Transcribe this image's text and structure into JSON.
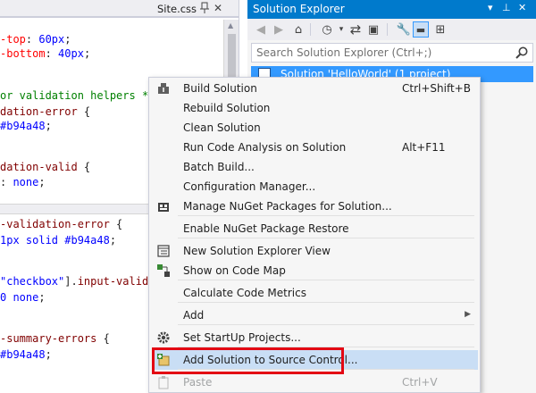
{
  "colors": {
    "accent": "#007acc",
    "selection": "#3399ff",
    "menu_highlight": "#c9def5",
    "callout_border": "#e30613",
    "css_property": "#ff0000",
    "css_value": "#0000ff",
    "css_comment": "#008000"
  },
  "editor": {
    "tab_name": "Site.css",
    "pin_icon": "pin-icon",
    "close_icon": "close-icon",
    "lines_top": [
      {
        "parts": [
          [
            "prop",
            "-top"
          ],
          [
            "txt",
            ": "
          ],
          [
            "val",
            "60px"
          ],
          [
            "txt",
            ";"
          ]
        ]
      },
      {
        "parts": [
          [
            "prop",
            "-bottom"
          ],
          [
            "txt",
            ": "
          ],
          [
            "val",
            "40px"
          ],
          [
            "txt",
            ";"
          ]
        ]
      },
      {
        "parts": [
          [
            "com",
            "or validation helpers */"
          ]
        ]
      },
      {
        "parts": [
          [
            "sel",
            "dation-error"
          ],
          [
            "txt",
            " {"
          ]
        ]
      },
      {
        "parts": [
          [
            "val",
            "#b94a48"
          ],
          [
            "txt",
            ";"
          ]
        ]
      },
      {
        "parts": [
          [
            "sel",
            "dation-valid"
          ],
          [
            "txt",
            " {"
          ]
        ]
      },
      {
        "parts": [
          [
            "txt",
            ": "
          ],
          [
            "val",
            "none"
          ],
          [
            "txt",
            ";"
          ]
        ]
      }
    ],
    "lines_bottom": [
      {
        "parts": [
          [
            "sel",
            "-validation-error"
          ],
          [
            "txt",
            " {"
          ]
        ]
      },
      {
        "parts": [
          [
            "val",
            "1px solid #b94a48"
          ],
          [
            "txt",
            ";"
          ]
        ]
      },
      {
        "parts": [
          [
            "val",
            "\"checkbox\""
          ],
          [
            "txt",
            "]."
          ],
          [
            "sel",
            "input-validat"
          ]
        ]
      },
      {
        "parts": [
          [
            "val",
            "0 none"
          ],
          [
            "txt",
            ";"
          ]
        ]
      },
      {
        "parts": [
          [
            "sel",
            "-summary-errors"
          ],
          [
            "txt",
            " {"
          ]
        ]
      },
      {
        "parts": [
          [
            "val",
            "#b94a48"
          ],
          [
            "txt",
            ";"
          ]
        ]
      }
    ]
  },
  "solution_explorer": {
    "title": "Solution Explorer",
    "title_controls": [
      "▾",
      "⊥",
      "✕"
    ],
    "toolbar_icons": [
      "back-icon",
      "forward-icon",
      "home-icon",
      "history-icon",
      "sync-icon",
      "collapse-icon",
      "properties-icon",
      "preview-icon",
      "code-map-icon"
    ],
    "search": {
      "placeholder": "Search Solution Explorer (Ctrl+;)",
      "value": ""
    },
    "selected_item": "Solution 'HelloWorld' (1 project)"
  },
  "context_menu": {
    "items": [
      {
        "label": "Build Solution",
        "shortcut": "Ctrl+Shift+B",
        "icon": "build-icon"
      },
      {
        "label": "Rebuild Solution",
        "shortcut": "",
        "icon": ""
      },
      {
        "label": "Clean Solution",
        "shortcut": "",
        "icon": ""
      },
      {
        "label": "Run Code Analysis on Solution",
        "shortcut": "Alt+F11",
        "icon": ""
      },
      {
        "label": "Batch Build...",
        "shortcut": "",
        "icon": ""
      },
      {
        "label": "Configuration Manager...",
        "shortcut": "",
        "icon": ""
      },
      {
        "label": "Manage NuGet Packages for Solution...",
        "shortcut": "",
        "icon": "nuget-icon"
      },
      {
        "label": "Enable NuGet Package Restore",
        "shortcut": "",
        "icon": ""
      },
      {
        "label": "New Solution Explorer View",
        "shortcut": "",
        "icon": "new-view-icon"
      },
      {
        "label": "Show on Code Map",
        "shortcut": "",
        "icon": "code-map-icon"
      },
      {
        "label": "Calculate Code Metrics",
        "shortcut": "",
        "icon": ""
      },
      {
        "label": "Add",
        "shortcut": "",
        "icon": "",
        "submenu_arrow": "▶"
      },
      {
        "label": "Set StartUp Projects...",
        "shortcut": "",
        "icon": "gear-icon"
      },
      {
        "label": "Add Solution to Source Control...",
        "shortcut": "",
        "icon": "source-control-icon"
      },
      {
        "label": "Paste",
        "shortcut": "Ctrl+V",
        "icon": "paste-icon"
      }
    ]
  }
}
